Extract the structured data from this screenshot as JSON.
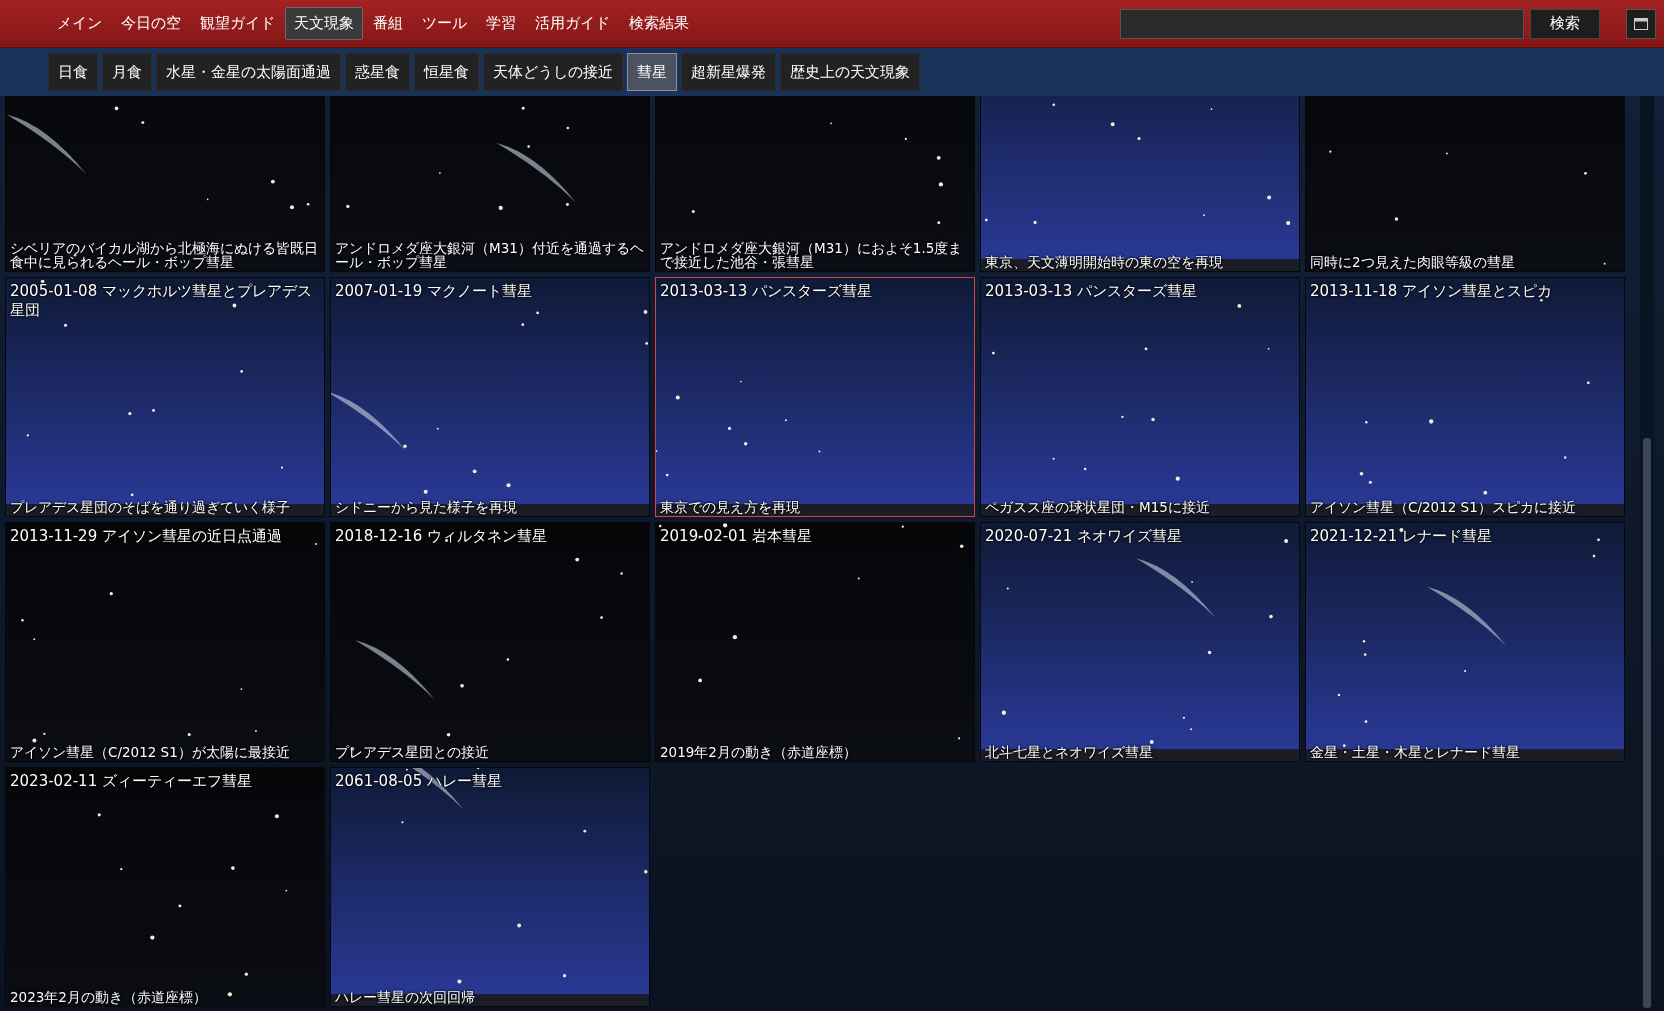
{
  "main_nav": [
    {
      "label": "メイン",
      "selected": false
    },
    {
      "label": "今日の空",
      "selected": false
    },
    {
      "label": "観望ガイド",
      "selected": false
    },
    {
      "label": "天文現象",
      "selected": true
    },
    {
      "label": "番組",
      "selected": false
    },
    {
      "label": "ツール",
      "selected": false
    },
    {
      "label": "学習",
      "selected": false
    },
    {
      "label": "活用ガイド",
      "selected": false
    },
    {
      "label": "検索結果",
      "selected": false
    }
  ],
  "search": {
    "button": "検索"
  },
  "sub_nav": [
    {
      "label": "日食",
      "selected": false
    },
    {
      "label": "月食",
      "selected": false
    },
    {
      "label": "水星・金星の太陽面通過",
      "selected": false
    },
    {
      "label": "惑星食",
      "selected": false
    },
    {
      "label": "恒星食",
      "selected": false
    },
    {
      "label": "天体どうしの接近",
      "selected": false
    },
    {
      "label": "彗星",
      "selected": true
    },
    {
      "label": "超新星爆発",
      "selected": false
    },
    {
      "label": "歴史上の天文現象",
      "selected": false
    }
  ],
  "tiles": [
    {
      "caption": "シベリアのバイカル湖から北極海にぬける皆既日食中に見られるヘール・ボップ彗星",
      "selected": false
    },
    {
      "caption": "アンドロメダ座大銀河（M31）付近を通過するヘール・ボップ彗星",
      "selected": false
    },
    {
      "caption": "アンドロメダ座大銀河（M31）におよそ1.5度まで接近した池谷・張彗星",
      "selected": false
    },
    {
      "caption": "東京、天文薄明開始時の東の空を再現",
      "selected": false
    },
    {
      "caption": "同時に2つ見えた肉眼等級の彗星",
      "selected": false
    },
    {
      "title": "2005-01-08 マックホルツ彗星とプレアデス星団",
      "caption": "プレアデス星団のそばを通り過ぎていく様子",
      "selected": false
    },
    {
      "title": "2007-01-19 マクノート彗星",
      "caption": "シドニーから見た様子を再現",
      "selected": false
    },
    {
      "title": "2013-03-13 パンスターズ彗星",
      "caption": "東京での見え方を再現",
      "selected": true
    },
    {
      "title": "2013-03-13 パンスターズ彗星",
      "caption": "ペガスス座の球状星団・M15に接近",
      "selected": false
    },
    {
      "title": "2013-11-18 アイソン彗星とスピカ",
      "caption": "アイソン彗星（C/2012 S1）スピカに接近",
      "selected": false
    },
    {
      "title": "2013-11-29 アイソン彗星の近日点通過",
      "caption": "アイソン彗星（C/2012 S1）が太陽に最接近",
      "selected": false
    },
    {
      "title": "2018-12-16 ウィルタネン彗星",
      "caption": "プレアデス星団との接近",
      "selected": false
    },
    {
      "title": "2019-02-01 岩本彗星",
      "caption": "2019年2月の動き（赤道座標）",
      "selected": false
    },
    {
      "title": "2020-07-21 ネオワイズ彗星",
      "caption": "北斗七星とネオワイズ彗星",
      "selected": false
    },
    {
      "title": "2021-12-21 レナード彗星",
      "caption": "金星・土星・木星とレナード彗星",
      "selected": false
    },
    {
      "title": "2023-02-11 ズィーティーエフ彗星",
      "caption": "2023年2月の動き（赤道座標）",
      "selected": false
    },
    {
      "title": "2061-08-05 ハレー彗星",
      "caption": "ハレー彗星の次回回帰",
      "selected": false
    }
  ]
}
